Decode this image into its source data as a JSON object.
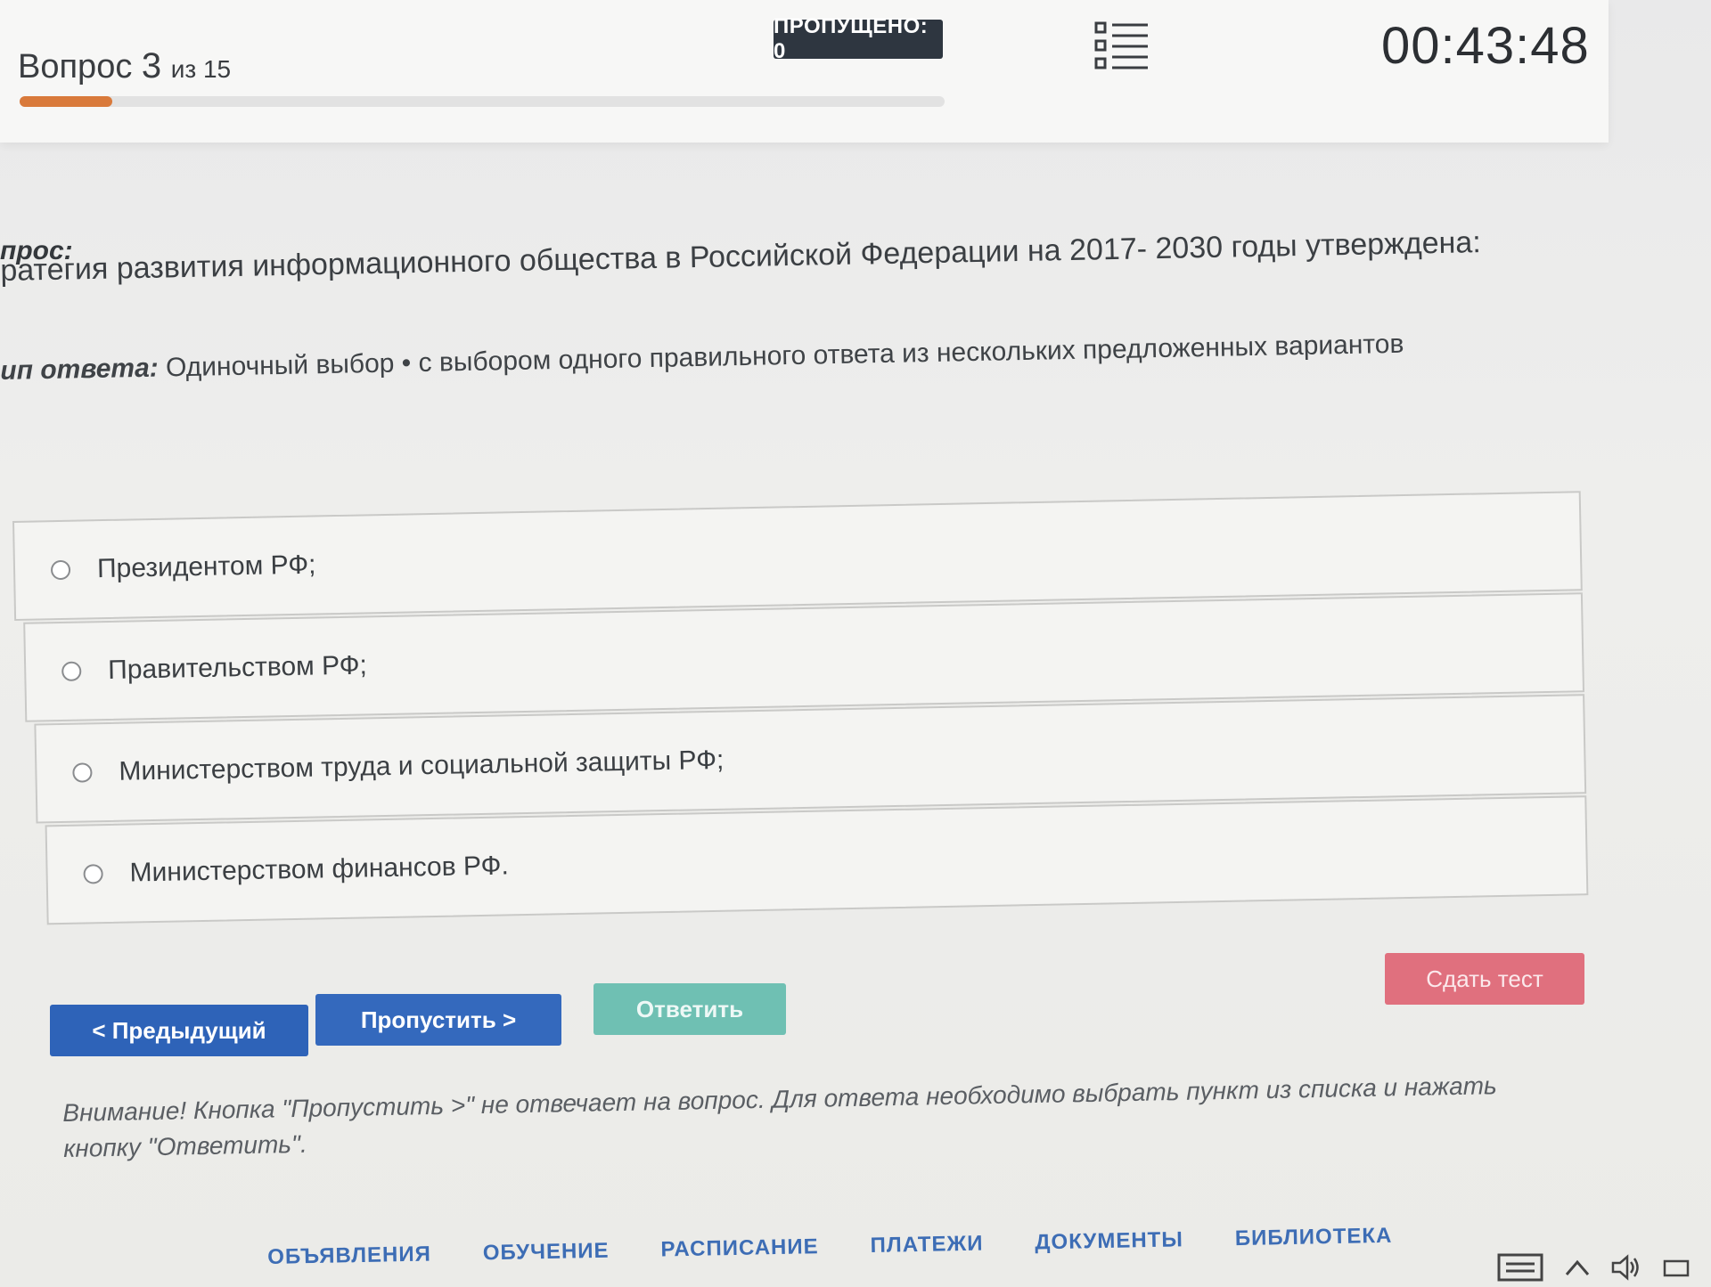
{
  "header": {
    "question_prefix": "Вопрос",
    "question_number": "3",
    "question_of": "из 15",
    "progress_fraction": 0.1,
    "skipped_badge": "ПРОПУЩЕНО: 0",
    "timer": "00:43:48"
  },
  "question": {
    "label": "прос:",
    "text": "ратегия развития информационного общества в Российской Федерации на 2017- 2030 годы утверждена:",
    "answer_type_label": "ип ответа:",
    "answer_type_value": "Одиночный выбор • с выбором одного правильного ответа из нескольких предложенных вариантов"
  },
  "options": [
    {
      "label": "Президентом РФ;"
    },
    {
      "label": "Правительством РФ;"
    },
    {
      "label": "Министерством труда и социальной защиты РФ;"
    },
    {
      "label": "Министерством финансов РФ."
    }
  ],
  "buttons": {
    "prev": "< Предыдущий",
    "skip": "Пропустить >",
    "answer": "Ответить",
    "submit": "Сдать тест"
  },
  "warning": "Внимание! Кнопка \"Пропустить >\" не отвечает на вопрос. Для ответа необходимо выбрать пункт из списка и нажать кнопку \"Ответить\".",
  "bottom_nav": [
    "ОБЪЯВЛЕНИЯ",
    "ОБУЧЕНИЕ",
    "РАСПИСАНИЕ",
    "ПЛАТЕЖИ",
    "ДОКУМЕНТЫ",
    "БИБЛИОТЕКА"
  ],
  "colors": {
    "progress": "#d97a3b",
    "primary_button": "#2e63b8",
    "answer_button": "#6fc0b3",
    "submit_button": "#e0707e",
    "nav_link": "#3d6db5"
  }
}
